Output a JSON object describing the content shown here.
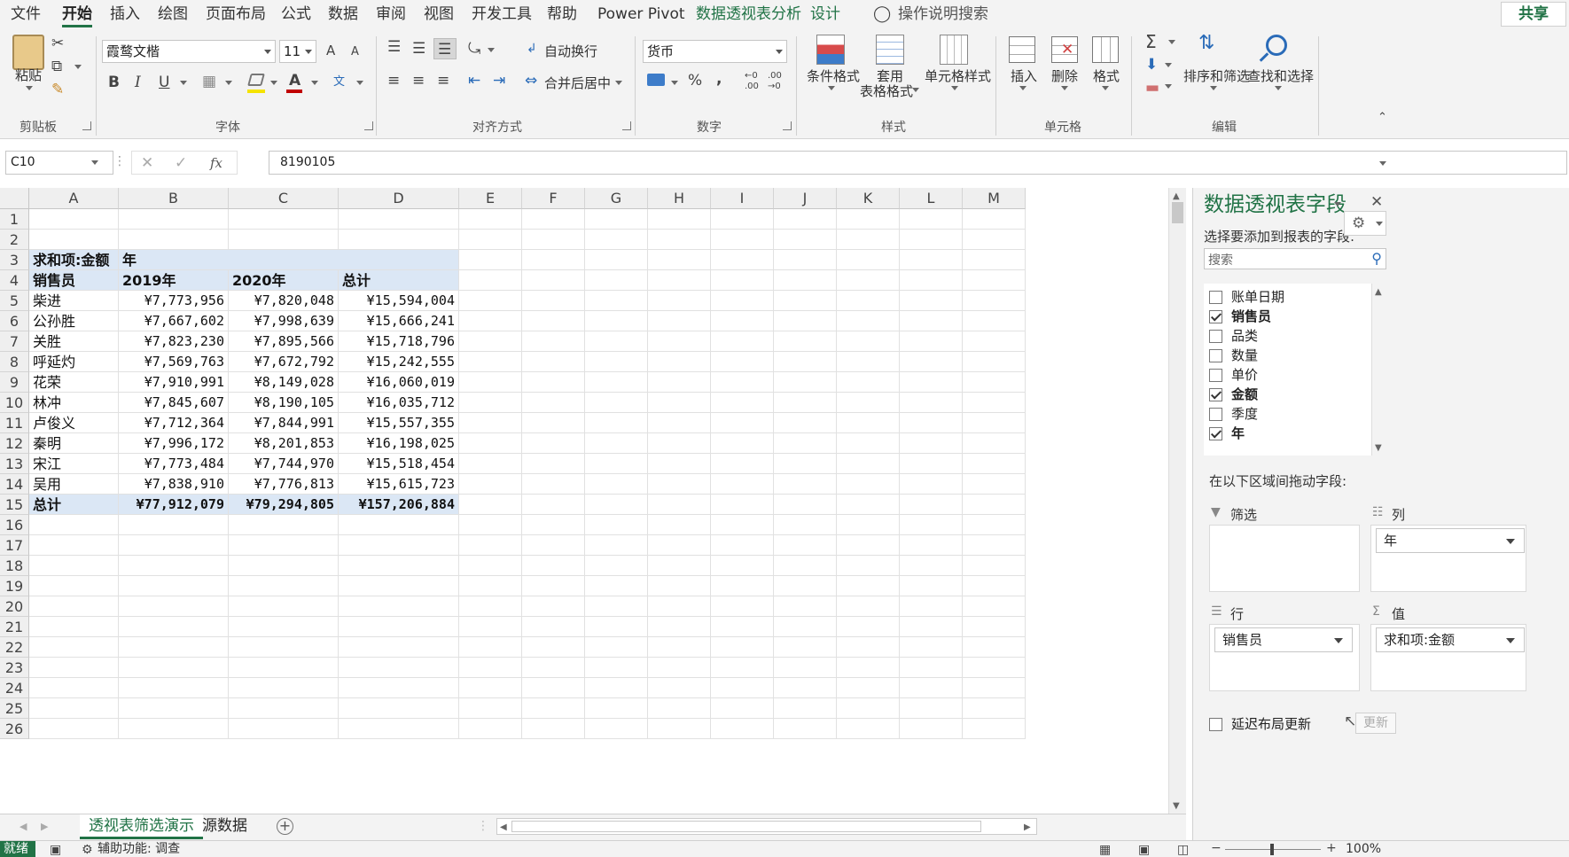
{
  "menu": {
    "tabs": [
      "文件",
      "开始",
      "插入",
      "绘图",
      "页面布局",
      "公式",
      "数据",
      "审阅",
      "视图",
      "开发工具",
      "帮助",
      "Power Pivot",
      "数据透视表分析",
      "设计"
    ],
    "active": "开始",
    "tell_me": "操作说明搜索",
    "share": "共享"
  },
  "ribbon": {
    "clipboard": {
      "paste": "粘贴",
      "label": "剪贴板"
    },
    "font": {
      "name": "霞鹜文楷",
      "size": "11",
      "grow": "A",
      "shrink": "A",
      "bold": "B",
      "italic": "I",
      "underline": "U",
      "color_glyph": "A",
      "phonetic": "文",
      "label": "字体"
    },
    "alignment": {
      "wrap": "自动换行",
      "merge": "合并后居中",
      "label": "对齐方式"
    },
    "number": {
      "format": "货币",
      "percent": "%",
      "comma": ",",
      "inc_decimal_top": "←0",
      "inc_decimal_bottom": ".00",
      "dec_decimal_top": ".00",
      "dec_decimal_bottom": "→0",
      "label": "数字"
    },
    "styles": {
      "conditional": "条件格式",
      "table_l1": "套用",
      "table_l2": "表格格式",
      "cell_styles": "单元格样式",
      "label": "样式"
    },
    "cells": {
      "insert": "插入",
      "delete": "删除",
      "format": "格式",
      "label": "单元格"
    },
    "editing": {
      "sort_filter": "排序和筛选",
      "find_select": "查找和选择",
      "label": "编辑"
    }
  },
  "formula_bar": {
    "name_box": "C10",
    "fx": "fx",
    "value": "8190105"
  },
  "grid": {
    "columns": [
      "A",
      "B",
      "C",
      "D",
      "E",
      "F",
      "G",
      "H",
      "I",
      "J",
      "K",
      "L",
      "M"
    ],
    "rows": [
      "1",
      "2",
      "3",
      "4",
      "5",
      "6",
      "7",
      "8",
      "9",
      "10",
      "11",
      "12",
      "13",
      "14",
      "15",
      "16",
      "17",
      "18",
      "19",
      "20",
      "21",
      "22",
      "23",
      "24",
      "25",
      "26"
    ],
    "pivot": {
      "value_field": "求和项:金额",
      "col_field": "年",
      "row_field": "销售员",
      "col_headers": [
        "2019年",
        "2020年",
        "总计"
      ],
      "rows": [
        {
          "name": "柴进",
          "v2019": "¥7,773,956",
          "v2020": "¥7,820,048",
          "total": "¥15,594,004"
        },
        {
          "name": "公孙胜",
          "v2019": "¥7,667,602",
          "v2020": "¥7,998,639",
          "total": "¥15,666,241"
        },
        {
          "name": "关胜",
          "v2019": "¥7,823,230",
          "v2020": "¥7,895,566",
          "total": "¥15,718,796"
        },
        {
          "name": "呼延灼",
          "v2019": "¥7,569,763",
          "v2020": "¥7,672,792",
          "total": "¥15,242,555"
        },
        {
          "name": "花荣",
          "v2019": "¥7,910,991",
          "v2020": "¥8,149,028",
          "total": "¥16,060,019"
        },
        {
          "name": "林冲",
          "v2019": "¥7,845,607",
          "v2020": "¥8,190,105",
          "total": "¥16,035,712"
        },
        {
          "name": "卢俊义",
          "v2019": "¥7,712,364",
          "v2020": "¥7,844,991",
          "total": "¥15,557,355"
        },
        {
          "name": "秦明",
          "v2019": "¥7,996,172",
          "v2020": "¥8,201,853",
          "total": "¥16,198,025"
        },
        {
          "name": "宋江",
          "v2019": "¥7,773,484",
          "v2020": "¥7,744,970",
          "total": "¥15,518,454"
        },
        {
          "name": "吴用",
          "v2019": "¥7,838,910",
          "v2020": "¥7,776,813",
          "total": "¥15,615,723"
        }
      ],
      "grand": {
        "name": "总计",
        "v2019": "¥77,912,079",
        "v2020": "¥79,294,805",
        "total": "¥157,206,884"
      }
    }
  },
  "sheets": {
    "tabs": [
      "透视表筛选演示",
      "源数据"
    ],
    "active": "透视表筛选演示"
  },
  "status": {
    "ready": "就绪",
    "accessibility": "辅助功能: 调查",
    "zoom": "100%"
  },
  "pane": {
    "title": "数据透视表字段",
    "choose_label": "选择要添加到报表的字段:",
    "search_placeholder": "搜索",
    "fields": [
      {
        "name": "账单日期",
        "checked": false
      },
      {
        "name": "销售员",
        "checked": true
      },
      {
        "name": "品类",
        "checked": false
      },
      {
        "name": "数量",
        "checked": false
      },
      {
        "name": "单价",
        "checked": false
      },
      {
        "name": "金额",
        "checked": true
      },
      {
        "name": "季度",
        "checked": false
      },
      {
        "name": "年",
        "checked": true
      }
    ],
    "drag_label": "在以下区域间拖动字段:",
    "areas": {
      "filter": {
        "label": "筛选"
      },
      "columns": {
        "label": "列",
        "item": "年"
      },
      "rows": {
        "label": "行",
        "item": "销售员"
      },
      "values": {
        "label": "值",
        "item": "求和项:金额"
      }
    },
    "defer_label": "延迟布局更新",
    "update": "更新"
  },
  "colors": {
    "accent": "#217346",
    "pivot_header": "#dbe7f5"
  }
}
